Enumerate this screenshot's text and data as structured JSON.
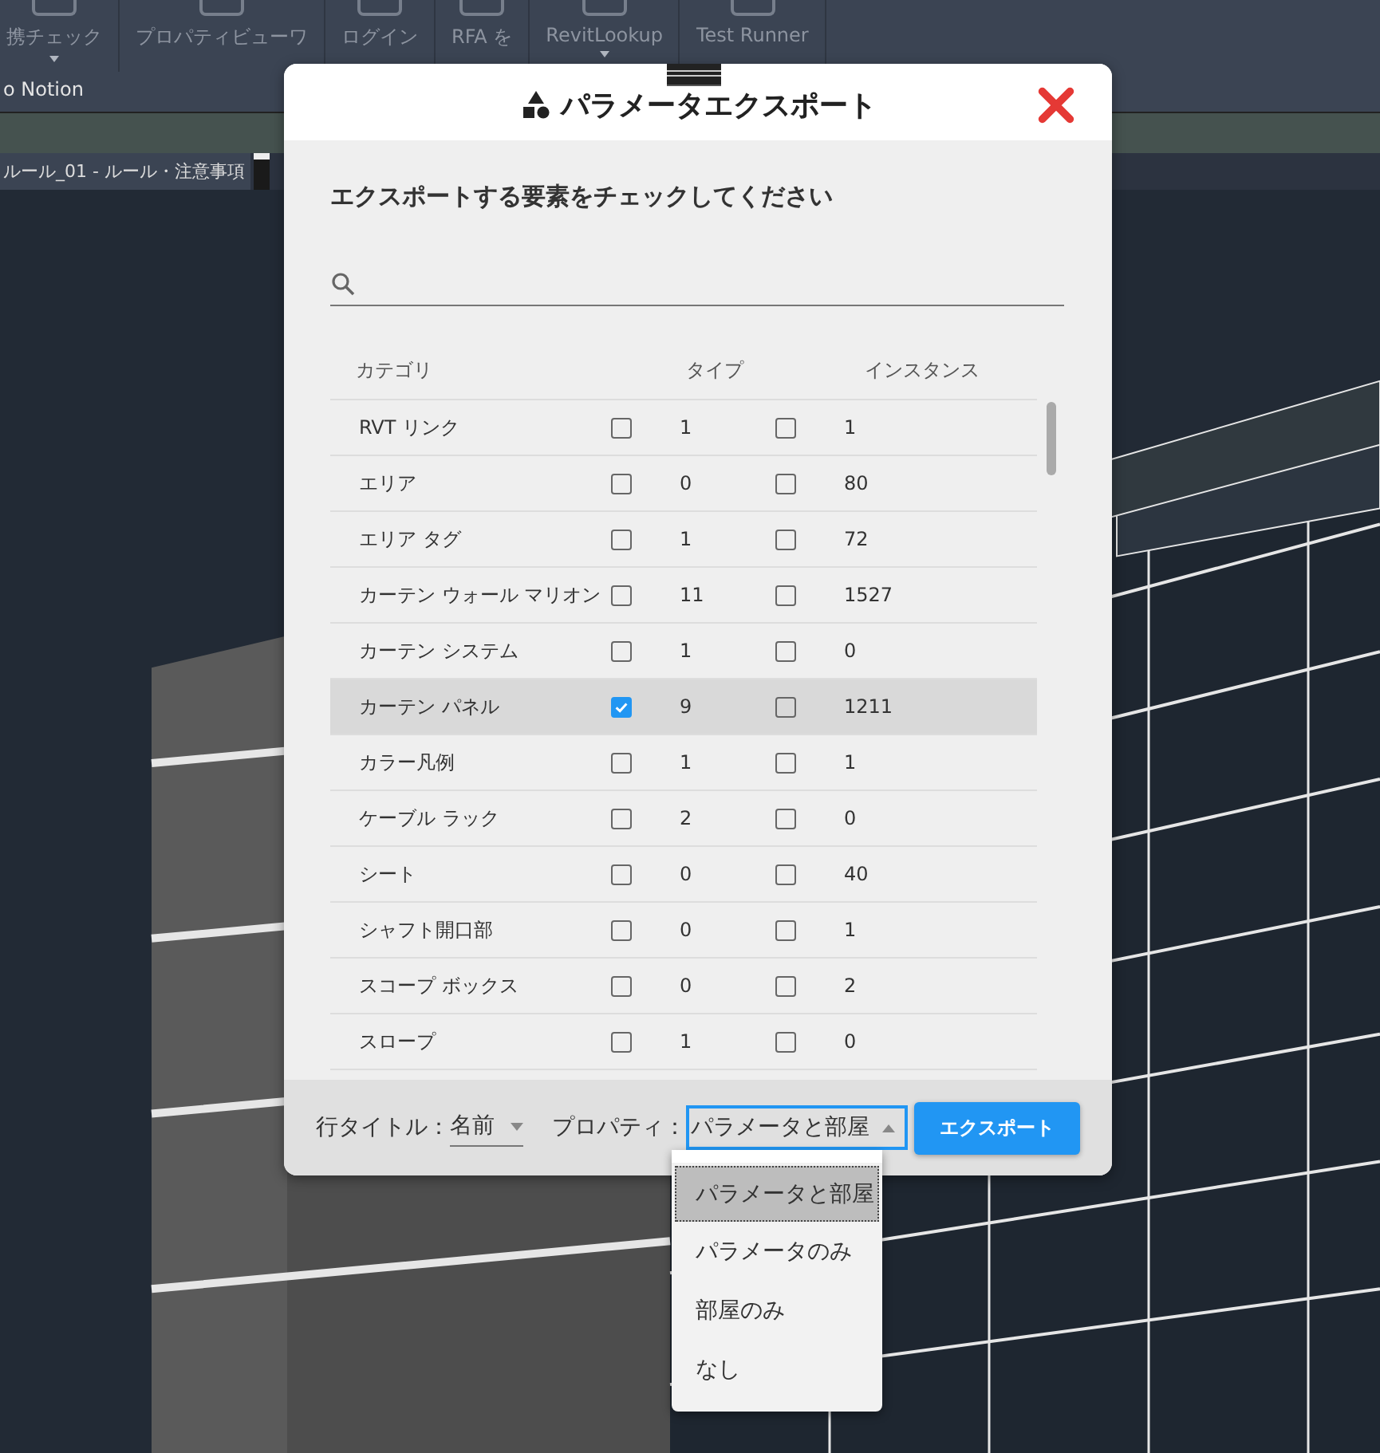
{
  "ribbon": {
    "buttons": [
      {
        "label": "携チェック",
        "dropdown": true
      },
      {
        "label": "プロパティビューワ",
        "dropdown": false
      },
      {
        "label": "ログイン",
        "dropdown": false
      },
      {
        "label": "RFA を",
        "dropdown": false
      },
      {
        "label": "RevitLookup",
        "dropdown": true
      },
      {
        "label": "Test Runner",
        "dropdown": false
      }
    ],
    "panel_label": "o Notion"
  },
  "view_tab": {
    "title": "ルール_01 - ルール・注意事項"
  },
  "dialog": {
    "title": "パラメータエクスポート",
    "instruction": "エクスポートする要素をチェックしてください",
    "table": {
      "columns": [
        "カテゴリ",
        "タイプ",
        "インスタンス"
      ],
      "rows": [
        {
          "category": "RVT リンク",
          "type_checked": false,
          "type_count": "1",
          "instance_checked": false,
          "instance_count": "1",
          "selected": false
        },
        {
          "category": "エリア",
          "type_checked": false,
          "type_count": "0",
          "instance_checked": false,
          "instance_count": "80",
          "selected": false
        },
        {
          "category": "エリア タグ",
          "type_checked": false,
          "type_count": "1",
          "instance_checked": false,
          "instance_count": "72",
          "selected": false
        },
        {
          "category": "カーテン ウォール マリオン",
          "type_checked": false,
          "type_count": "11",
          "instance_checked": false,
          "instance_count": "1527",
          "selected": false
        },
        {
          "category": "カーテン システム",
          "type_checked": false,
          "type_count": "1",
          "instance_checked": false,
          "instance_count": "0",
          "selected": false
        },
        {
          "category": "カーテン パネル",
          "type_checked": true,
          "type_count": "9",
          "instance_checked": false,
          "instance_count": "1211",
          "selected": true
        },
        {
          "category": "カラー凡例",
          "type_checked": false,
          "type_count": "1",
          "instance_checked": false,
          "instance_count": "1",
          "selected": false
        },
        {
          "category": "ケーブル ラック",
          "type_checked": false,
          "type_count": "2",
          "instance_checked": false,
          "instance_count": "0",
          "selected": false
        },
        {
          "category": "シート",
          "type_checked": false,
          "type_count": "0",
          "instance_checked": false,
          "instance_count": "40",
          "selected": false
        },
        {
          "category": "シャフト開口部",
          "type_checked": false,
          "type_count": "0",
          "instance_checked": false,
          "instance_count": "1",
          "selected": false
        },
        {
          "category": "スコープ ボックス",
          "type_checked": false,
          "type_count": "0",
          "instance_checked": false,
          "instance_count": "2",
          "selected": false
        },
        {
          "category": "スロープ",
          "type_checked": false,
          "type_count": "1",
          "instance_checked": false,
          "instance_count": "0",
          "selected": false
        }
      ]
    },
    "row_title": {
      "label": "行タイトル：",
      "value": "名前"
    },
    "property": {
      "label": "プロパティ：",
      "value": "パラメータと部屋",
      "expanded": true,
      "options": [
        {
          "label": "パラメータと部屋",
          "selected": true
        },
        {
          "label": "パラメータのみ",
          "selected": false
        },
        {
          "label": "部屋のみ",
          "selected": false
        },
        {
          "label": "なし",
          "selected": false
        }
      ]
    },
    "export_button": "エクスポート"
  }
}
